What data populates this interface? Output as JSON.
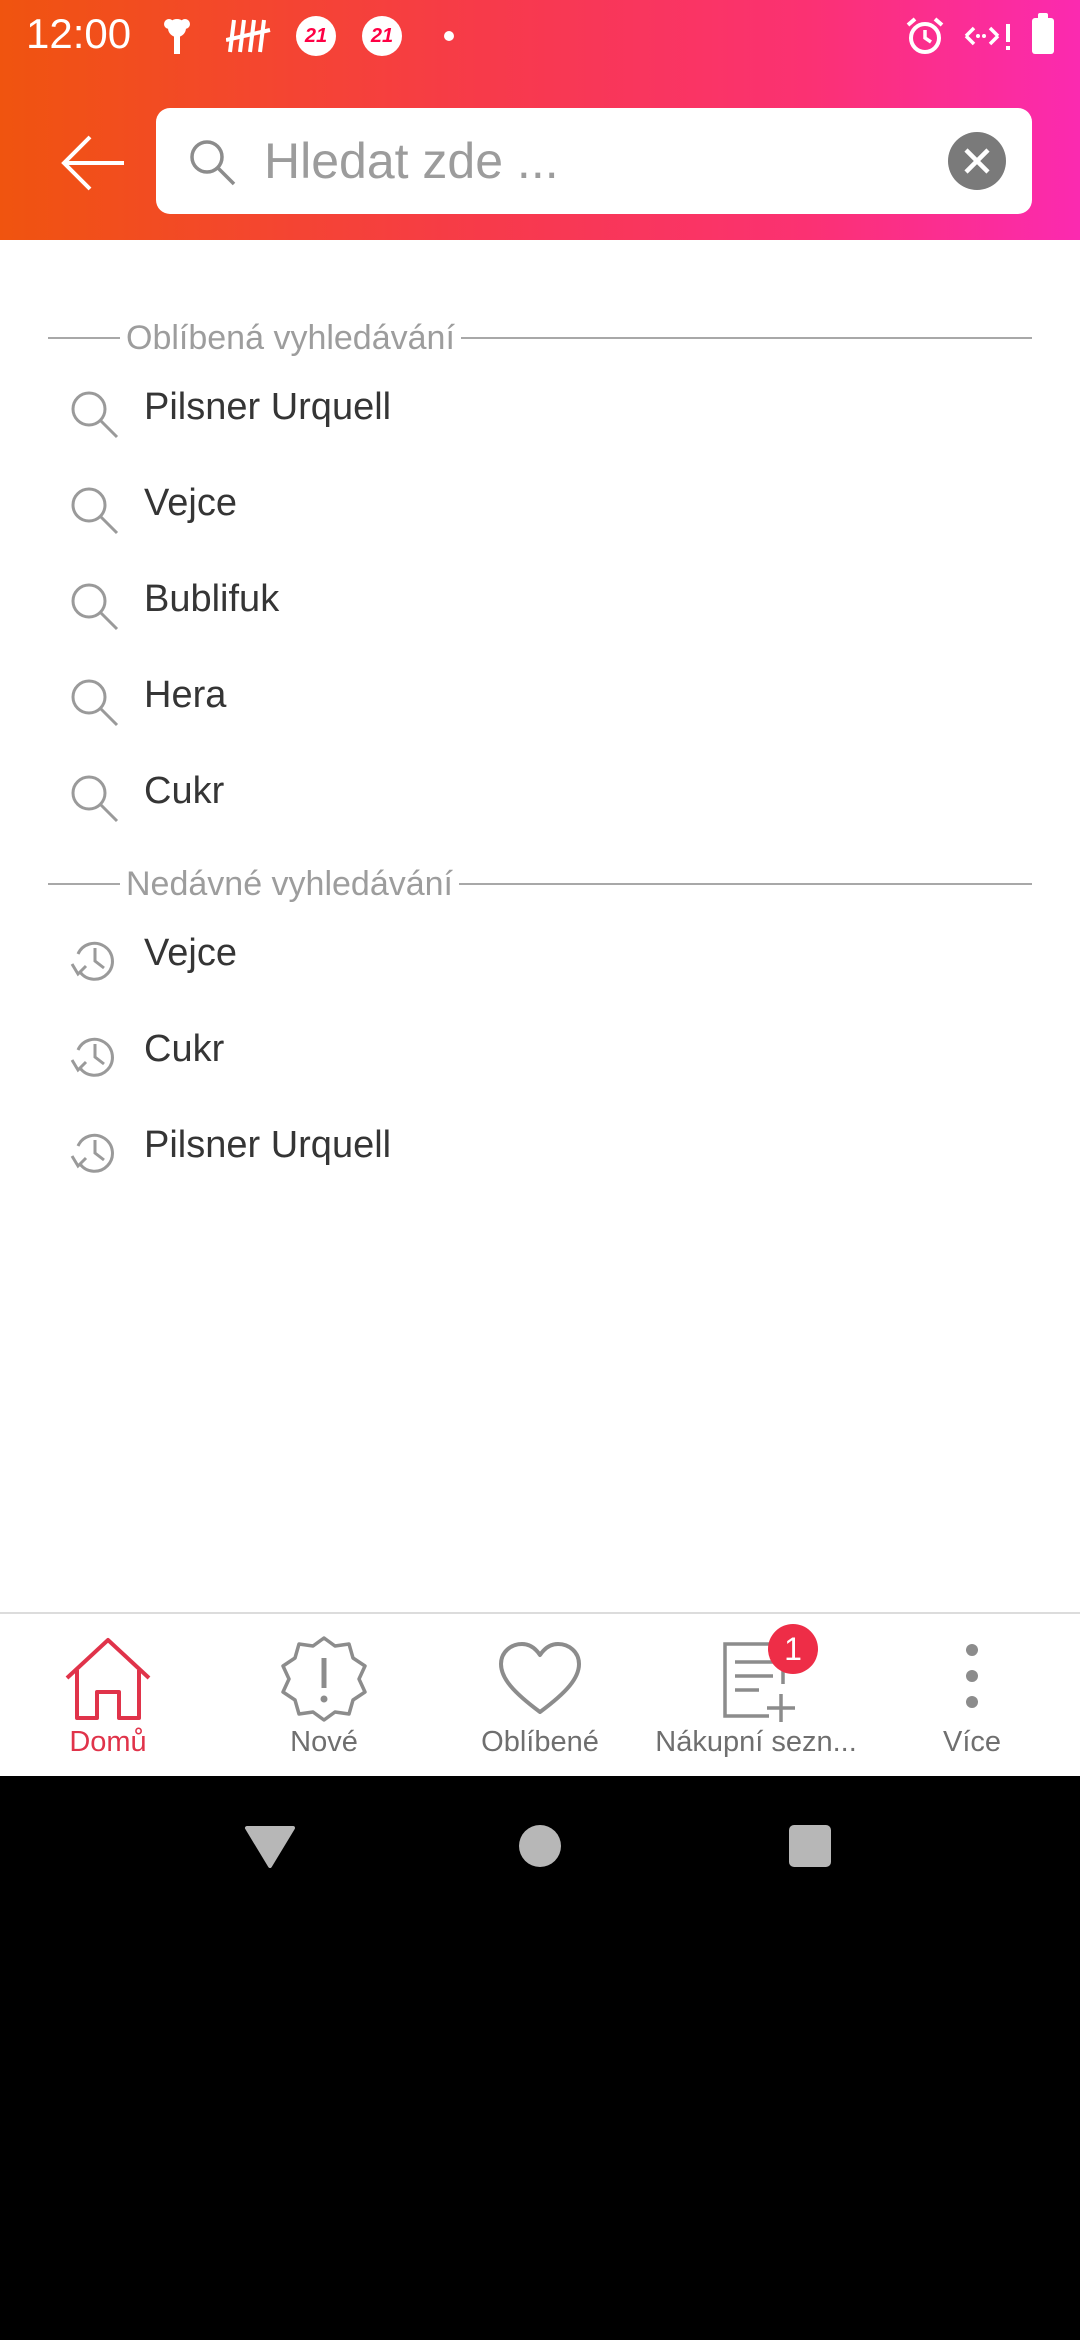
{
  "status_bar": {
    "time": "12:00",
    "badges": [
      "21",
      "21"
    ],
    "icons": [
      "flower-icon",
      "tally-icon",
      "badge-21-icon",
      "badge-21-icon",
      "dot-icon",
      "alarm-icon",
      "data-icon",
      "battery-icon"
    ]
  },
  "search": {
    "placeholder": "Hledat zde ...",
    "value": ""
  },
  "favorites": {
    "title": "Oblíbená vyhledávání",
    "items": [
      "Pilsner Urquell",
      "Vejce",
      "Bublifuk",
      "Hera",
      "Cukr"
    ]
  },
  "recent": {
    "title": "Nedávné vyhledávání",
    "items": [
      "Vejce",
      "Cukr",
      "Pilsner Urquell"
    ]
  },
  "bottom_nav": {
    "items": [
      {
        "label": "Domů",
        "icon": "home-icon",
        "active": true
      },
      {
        "label": "Nové",
        "icon": "alert-badge-icon"
      },
      {
        "label": "Oblíbené",
        "icon": "heart-icon"
      },
      {
        "label": "Nákupní sezn...",
        "icon": "shopping-list-icon",
        "badge": "1"
      },
      {
        "label": "Více",
        "icon": "more-vertical-icon"
      }
    ]
  },
  "colors": {
    "accent": "#e0334a",
    "gradient_start": "#f0540f",
    "gradient_end": "#fb2ab0"
  }
}
